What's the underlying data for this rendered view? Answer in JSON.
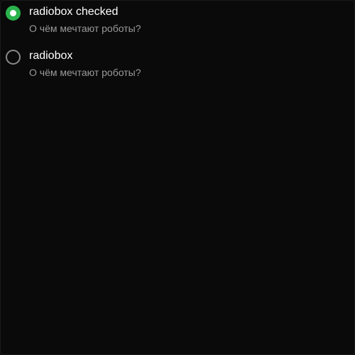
{
  "radios": [
    {
      "label": "radiobox checked",
      "description": "О чём мечтают роботы?",
      "checked": true
    },
    {
      "label": "radiobox",
      "description": "О чём мечтают роботы?",
      "checked": false
    }
  ],
  "colors": {
    "background": "#0a0a0a",
    "accent": "#2bb24c",
    "description_text": "#9a9a9a",
    "unchecked_border": "#8a8a8a"
  },
  "icons": {
    "checked": "radio-checked-icon",
    "unchecked": "radio-unchecked-icon"
  }
}
